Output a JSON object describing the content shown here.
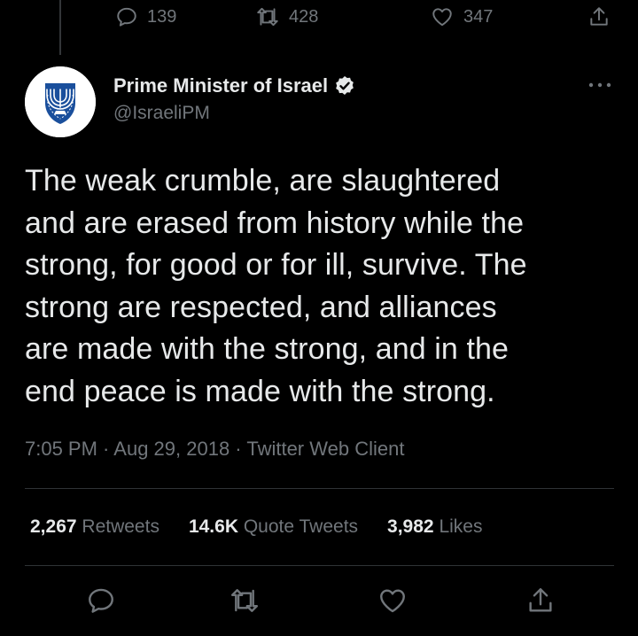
{
  "previous_tweet": {
    "replies": "139",
    "retweets": "428",
    "likes": "347"
  },
  "author": {
    "name": "Prime Minister of Israel",
    "handle": "@IsraeliPM",
    "verified": true
  },
  "tweet": {
    "lines": [
      "The weak crumble, are slaughtered",
      "and are erased from history while the",
      "strong, for good or for ill, survive. The",
      "strong are respected, and alliances",
      "are made with the strong, and in the",
      "end peace is made with the strong."
    ],
    "time": "7:05 PM",
    "date": "Aug 29, 2018",
    "source": "Twitter Web Client",
    "meta_separator": " · "
  },
  "stats": {
    "retweets_count": "2,267",
    "retweets_label": "Retweets",
    "quotes_count": "14.6K",
    "quotes_label": "Quote Tweets",
    "likes_count": "3,982",
    "likes_label": "Likes"
  },
  "icons": {
    "reply": "reply-icon",
    "retweet": "retweet-icon",
    "like": "heart-icon",
    "share": "share-icon",
    "verified": "verified-badge-icon",
    "more": "more-icon",
    "avatar": "state-emblem-menorah"
  },
  "colors": {
    "background": "#000000",
    "text_primary": "#e7e9ea",
    "text_secondary": "#71767b",
    "divider": "#2f3336",
    "emblem_blue": "#1a4f9c"
  }
}
